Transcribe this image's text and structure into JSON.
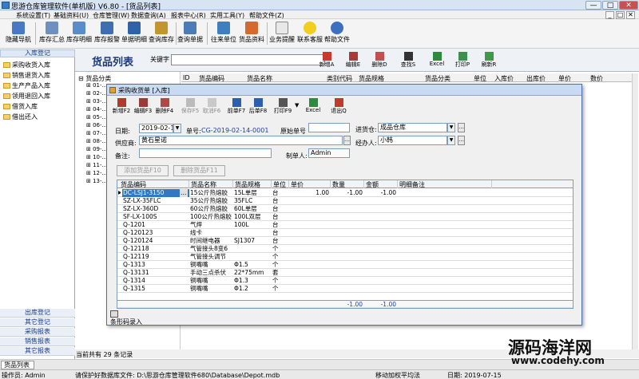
{
  "app": {
    "title": "思游仓库管理软件(单机版) V6.80 - [货品列表]",
    "window_controls": [
      "—",
      "□",
      "✕"
    ],
    "mdi_controls": [
      "_",
      "□",
      "✕"
    ]
  },
  "menu": [
    "系统设置(T)",
    "基础资料(U)",
    "仓库管理(W)",
    "数据查询(A)",
    "报表中心(R)",
    "实用工具(Y)",
    "帮助文件(Z)"
  ],
  "toolbar": [
    "隐藏导航",
    "库存汇总",
    "库存明细",
    "库存报警",
    "单据明细",
    "查询库存",
    "查询单据",
    "往来单位",
    "货品资料",
    "业务提醒",
    "联系客服",
    "帮助文件"
  ],
  "left_panel": {
    "header": "入库登记",
    "items": [
      "采购收货入库",
      "销售退货入库",
      "生产产品入库",
      "领用退回入库",
      "借货入库",
      "借出还入"
    ],
    "bottom": [
      "出库登记",
      "其它登记",
      "采购报表",
      "销售报表",
      "其它报表"
    ]
  },
  "list": {
    "title": "货品列表",
    "keyword_label": "关键字",
    "buttons": [
      "新增A",
      "编辑E",
      "删除D",
      "查找S",
      "Excel",
      "打印P",
      "刷新R"
    ],
    "columns": [
      "ID",
      "货品编码",
      "货品名称",
      "类别代码",
      "货品规格",
      "货品分类",
      "单位",
      "入库价",
      "出库价",
      "单价",
      "数价"
    ],
    "tree": {
      "root": "货品分类",
      "nodes": [
        "01-...",
        "02-...",
        "03-...",
        "04-...",
        "05-...",
        "06-...",
        "07-...",
        "08-...",
        "09-...",
        "10-...",
        "11-...",
        "12-...",
        "13-..."
      ]
    },
    "status": "当前共有 29 条记录"
  },
  "dialog": {
    "title": "采购收货单 [入库]",
    "toolbar": [
      "新增F2",
      "编辑F3",
      "删除F4",
      "保存F5",
      "取消F6",
      "前单F7",
      "后单F8",
      "打印F9",
      "Excel",
      "退出Q"
    ],
    "date_label": "日期:",
    "date": "2019-02-14",
    "docno_label": "单号:",
    "docno": "CG-2019-02-14-0001",
    "orig_label": "原始单号",
    "orig": "",
    "warehouse_label": "进货仓:",
    "warehouse": "成品仓库",
    "supplier_label": "供应商:",
    "supplier": "黄石星诺",
    "handler_label": "经办人:",
    "handler": "小韩",
    "remark_label": "备注:",
    "remark": "",
    "maker_label": "制单人:",
    "maker": "Admin",
    "add_btn": "添加货品F10",
    "del_btn": "删除货品F11",
    "columns": [
      "货品编码",
      "货品名称",
      "货品规格",
      "单位",
      "单价",
      "数量",
      "金额",
      "明细备注"
    ],
    "rows": [
      [
        "DC-LSJ1-3150",
        "15公斤热熔胶",
        "15L单层",
        "台",
        "1.00",
        "-1.00",
        "-1.00"
      ],
      [
        "SZ-LX-35FLC",
        "35公斤热熔胶",
        "35FLC",
        "台",
        "",
        "",
        ""
      ],
      [
        "SZ-LX-360D",
        "60公斤热熔胶",
        "60L单层",
        "台",
        "",
        "",
        ""
      ],
      [
        "SF-LX-100S",
        "100公斤热熔胶",
        "100L双层",
        "台",
        "",
        "",
        ""
      ],
      [
        "Q-1201",
        "气焊",
        "100L",
        "台",
        "",
        "",
        ""
      ],
      [
        "Q-120123",
        "线卡",
        "",
        "台",
        "",
        "",
        ""
      ],
      [
        "Q-120124",
        "时间继电器",
        "SJ1307",
        "台",
        "",
        "",
        ""
      ],
      [
        "Q-12118",
        "气管接头8变6",
        "",
        "个",
        "",
        "",
        ""
      ],
      [
        "Q-12119",
        "气管接头调节",
        "",
        "个",
        "",
        "",
        ""
      ],
      [
        "Q-1313",
        "铜嘴嘴",
        "Φ1.5",
        "个",
        "",
        "",
        ""
      ],
      [
        "Q-13131",
        "手动三点杀伏",
        "22*75mm",
        "套",
        "",
        "",
        ""
      ],
      [
        "Q-1314",
        "铜嘴嘴",
        "Φ1.3",
        "个",
        "",
        "",
        ""
      ],
      [
        "Q-1315",
        "铜嘴嘴",
        "Φ1.2",
        "个",
        "",
        "",
        ""
      ]
    ],
    "total_qty": "-1.00",
    "total_amount": "-1.00",
    "barcode_label": "条形码录入"
  },
  "tabs": [
    "货品列表"
  ],
  "status": [
    "操作员: Admin",
    "请保护好数据库文件: D:\\思游仓库管理软件680\\Database\\Depot.mdb",
    "移动加权平均法",
    "日期: 2019-07-15"
  ],
  "watermark": {
    "text": "源码海洋网",
    "url": "www.codehy.com"
  }
}
